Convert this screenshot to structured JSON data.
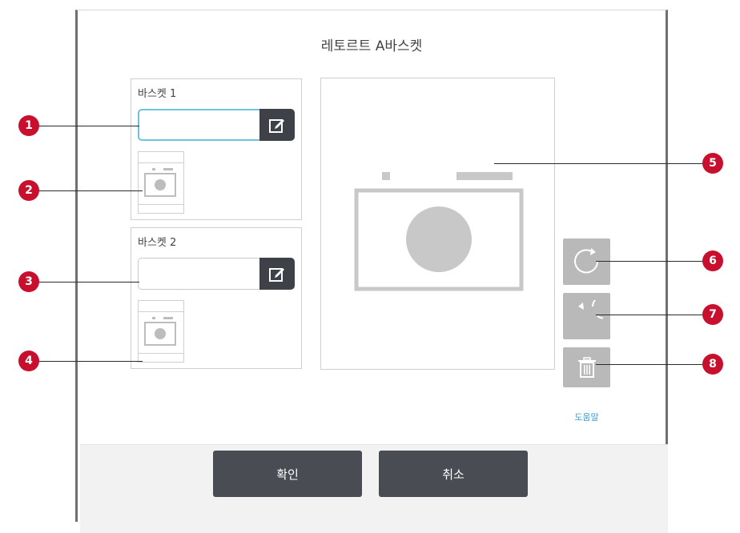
{
  "dialog": {
    "title": "레토르트 A바스켓"
  },
  "baskets": [
    {
      "label": "바스켓 1",
      "id_value": ""
    },
    {
      "label": "바스켓 2",
      "id_value": ""
    }
  ],
  "side_buttons": {
    "help_label": "도움말"
  },
  "footer": {
    "confirm_label": "확인",
    "cancel_label": "취소"
  },
  "callouts": [
    "1",
    "2",
    "3",
    "4",
    "5",
    "6",
    "7",
    "8"
  ],
  "colors": {
    "callout": "#c8102e",
    "button_dark": "#4a4c53",
    "button_gray": "#b9b9b9",
    "active_border": "#6cc3db",
    "link": "#3aa0d8"
  },
  "icons": {
    "edit": "pencil-square-icon",
    "rotate_cw": "rotate-clockwise-icon",
    "rotate_ccw": "rotate-counterclockwise-icon",
    "delete": "trash-icon"
  }
}
